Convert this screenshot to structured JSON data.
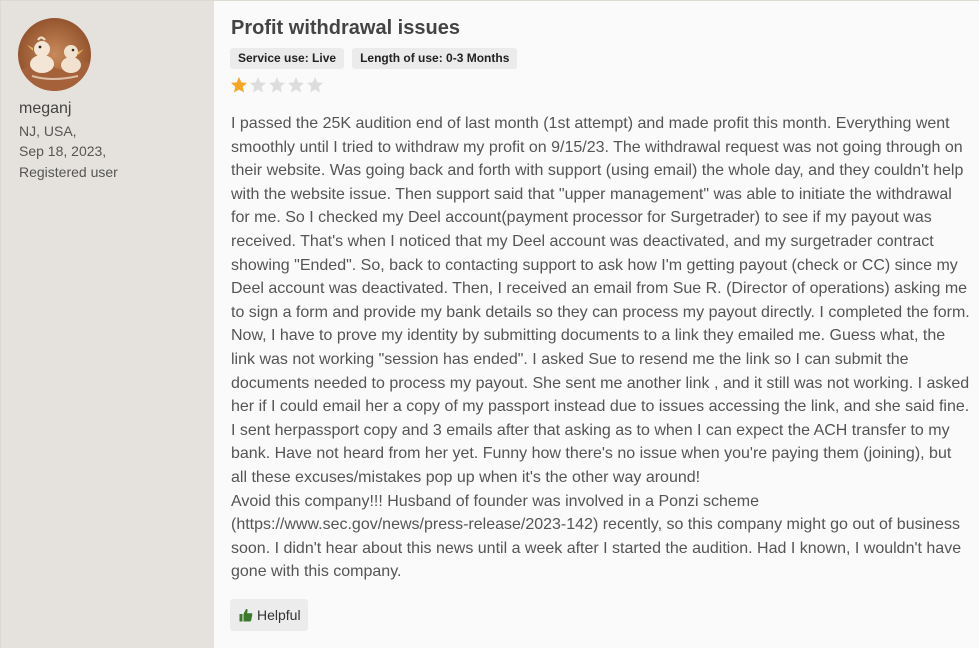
{
  "reviewer": {
    "name": "meganj",
    "location": "NJ, USA,",
    "date": "Sep 18, 2023,",
    "status": "Registered user",
    "avatar_icon": "bird-illustration-avatar"
  },
  "review": {
    "title": "Profit withdrawal issues",
    "tags": [
      "Service use: Live",
      "Length of use: 0-3 Months"
    ],
    "rating": 1,
    "rating_max": 5,
    "paragraphs": [
      "I passed the 25K audition end of last month (1st attempt) and made profit this month. Everything went smoothly until I tried to withdraw my profit on 9/15/23. The withdrawal request was not going through on their website. Was going back and forth with support (using email) the whole day, and they couldn't help with the website issue. Then support said that \"upper management\" was able to initiate the withdrawal for me. So I checked my Deel account(payment processor for Surgetrader) to see if my payout was received. That's when I noticed that my Deel account was deactivated, and my surgetrader contract showing \"Ended\". So, back to contacting support to ask how I'm getting payout (check or CC) since my Deel account was deactivated. Then, I received an email from Sue R. (Director of operations) asking me to sign a form and provide my bank details so they can process my payout directly. I completed the form. Now, I have to prove my identity by submitting documents to a link they emailed me. Guess what, the link was not working \"session has ended\". I asked Sue to resend me the link so I can submit the documents needed to process my payout. She sent me another link , and it still was not working. I asked her if I could email her a copy of my passport instead due to issues accessing the link, and she said fine. I sent herpassport copy and 3 emails after that asking as to when I can expect the ACH transfer to my bank. Have not heard from her yet. Funny how there's no issue when you're paying them (joining), but all these excuses/mistakes pop up when it's the other way around!",
      "Avoid this company!!! Husband of founder was involved in a Ponzi scheme (https://www.sec.gov/news/press-release/2023-142) recently, so this company might go out of business soon. I didn't hear about this news until a week after I started the audition. Had I known, I wouldn't have gone with this company."
    ],
    "helpful_label": "Helpful"
  },
  "colors": {
    "sidebar_bg": "#e5e2de",
    "star_filled": "#f5a623",
    "star_empty": "#dddddd",
    "thumb": "#3a7a2a"
  }
}
